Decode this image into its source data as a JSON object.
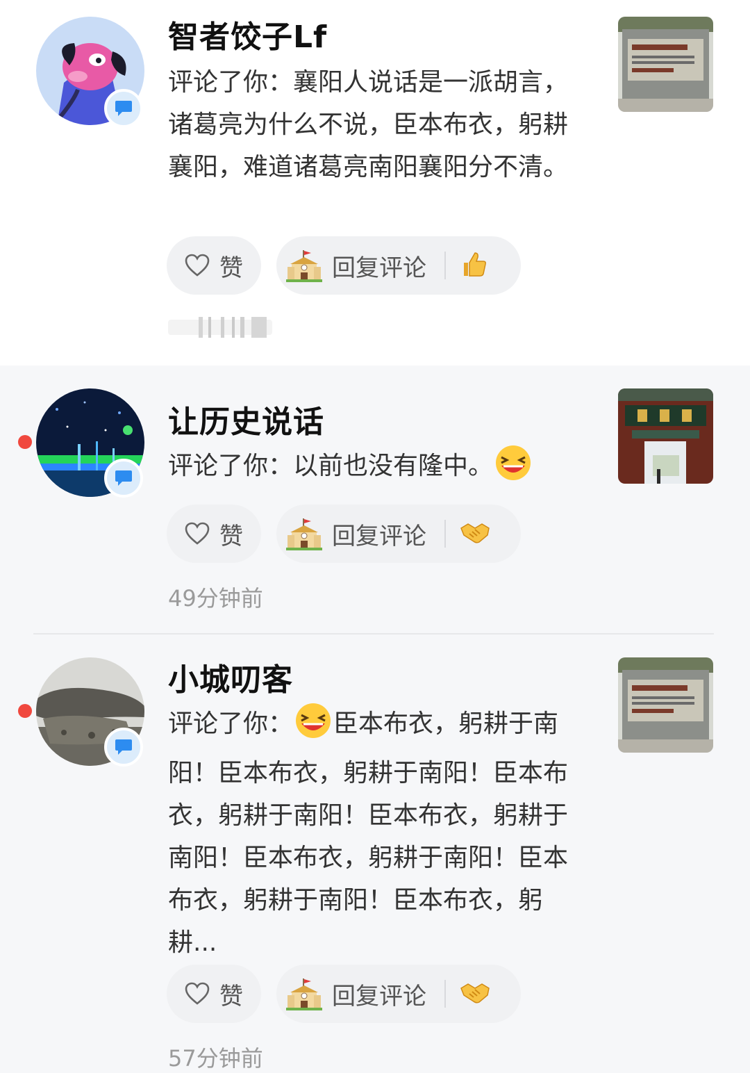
{
  "notifications": [
    {
      "username": "智者饺子Lf",
      "comment_text": "评论了你：襄阳人说话是一派胡言，诸葛亮为什么不说，臣本布衣，躬耕襄阳，难道诸葛亮南阳襄阳分不清。",
      "like_label": "赞",
      "reply_label": "回复评论",
      "time": "",
      "reaction_icon": "thumbs-up-icon",
      "unread": false
    },
    {
      "username": "让历史说话",
      "comment_prefix": "评论了你：以前也没有隆中。",
      "comment_emoji": "laughing-emoji",
      "like_label": "赞",
      "reply_label": "回复评论",
      "time": "49分钟前",
      "reaction_icon": "handshake-icon",
      "unread": true
    },
    {
      "username": "小城叨客",
      "comment_prefix": "评论了你：",
      "comment_emoji": "laughing-emoji",
      "comment_rest": "臣本布衣，躬耕于南阳！臣本布衣，躬耕于南阳！臣本布衣，躬耕于南阳！臣本布衣，躬耕于南阳！臣本布衣，躬耕于南阳！臣本布衣，躬耕于南阳！臣本布衣，躬耕...",
      "like_label": "赞",
      "reply_label": "回复评论",
      "time": "57分钟前",
      "reaction_icon": "handshake-icon",
      "unread": true
    }
  ],
  "colors": {
    "unread_dot": "#f0483e",
    "badge_bg": "#dcecfb",
    "badge_icon": "#2d8cf0",
    "pill_bg": "#f0f1f3",
    "read_bg": "#ffffff",
    "unread_bg": "#f6f7f9"
  }
}
